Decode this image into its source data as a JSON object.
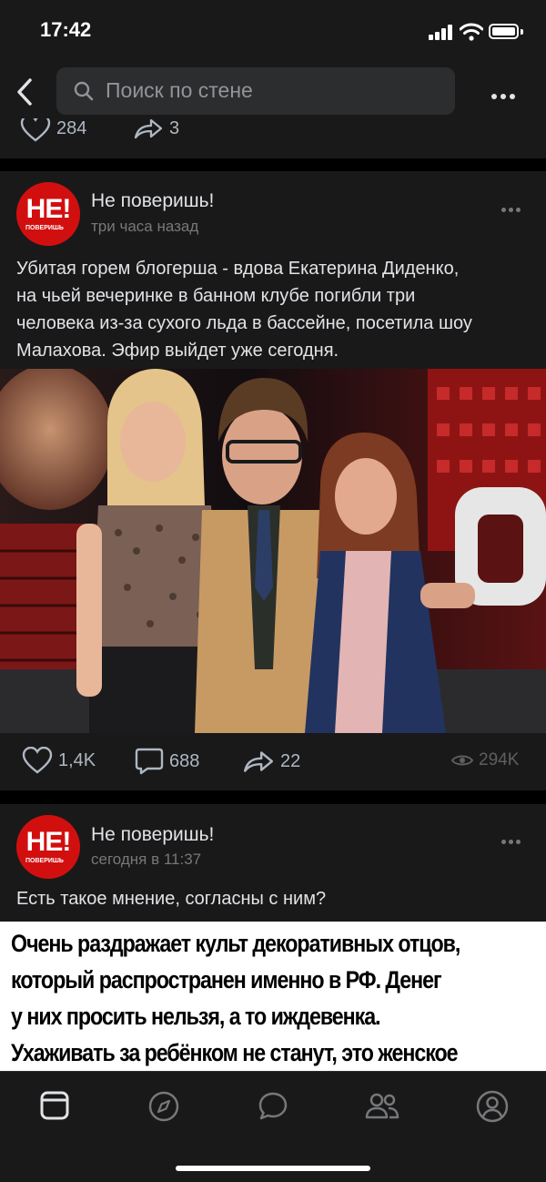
{
  "status_bar": {
    "time": "17:42"
  },
  "search": {
    "placeholder": "Поиск по стене"
  },
  "prev_post": {
    "likes": "284",
    "reposts": "3"
  },
  "posts": [
    {
      "author": "Не поверишь!",
      "time": "три часа назад",
      "avatar_text": "НЕ!",
      "avatar_sub": "ПОВЕРИШЬ",
      "text_lines": [
        "Убитая горем блогерша - вдова Екатерина Диденко,",
        "на чьей вечеринке в банном клубе погибли три",
        "человека из-за сухого льда в бассейне, посетила шоу",
        "Малахова. Эфир выйдет уже сегодня."
      ],
      "image_text": "Ф",
      "likes": "1,4K",
      "comments": "688",
      "reposts": "22",
      "views": "294K"
    },
    {
      "author": "Не поверишь!",
      "time": "сегодня в 11:37",
      "avatar_text": "НЕ!",
      "avatar_sub": "ПОВЕРИШЬ",
      "text": "Есть такое мнение, согласны с ним?",
      "quote_lines": [
        "Очень раздражает культ декоративных отцов,",
        "который распространен именно в РФ. Денег",
        "у них просить нельзя, а то иждевенка.",
        "Ухаживать за ребёнком не станут, это женское"
      ]
    }
  ],
  "tabbar": [
    "home-icon",
    "compass-icon",
    "messages-icon",
    "friends-icon",
    "profile-icon"
  ],
  "colors": {
    "background": "#19191a",
    "text": "#e1e3e6",
    "secondary": "#919499",
    "accent": "#d20f0f"
  }
}
